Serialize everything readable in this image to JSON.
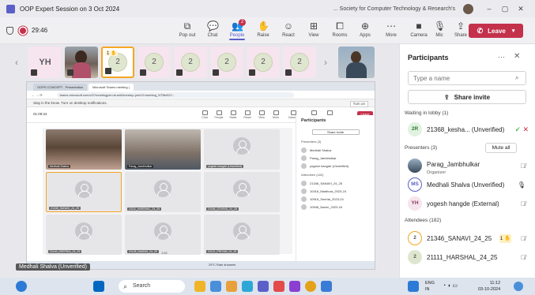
{
  "window": {
    "title": "OOP Expert Session on 3 Oct 2024",
    "org": "Society for Computer Technology & Research's",
    "more": "...",
    "min": "–",
    "max": "▢",
    "close": "✕"
  },
  "toolbar": {
    "timer": "29:46",
    "buttons": [
      {
        "label": "Pop out",
        "icon": "popout-icon",
        "glyph": "⧉"
      },
      {
        "label": "Chat",
        "icon": "chat-icon",
        "glyph": "💬"
      },
      {
        "label": "People",
        "icon": "people-icon",
        "glyph": "👥",
        "active": true,
        "badge": "2"
      },
      {
        "label": "Raise",
        "icon": "raise-hand-icon",
        "glyph": "✋"
      },
      {
        "label": "React",
        "icon": "react-icon",
        "glyph": "☺"
      },
      {
        "label": "View",
        "icon": "view-icon",
        "glyph": "⊞"
      },
      {
        "label": "Rooms",
        "icon": "rooms-icon",
        "glyph": "⧠"
      },
      {
        "label": "Apps",
        "icon": "apps-icon",
        "glyph": "⊕"
      },
      {
        "label": "More",
        "icon": "more-icon",
        "glyph": "⋯"
      },
      {
        "label": "Camera",
        "icon": "camera-icon",
        "glyph": "■"
      },
      {
        "label": "Mic",
        "icon": "mic-icon",
        "glyph": "🎙"
      },
      {
        "label": "Share",
        "icon": "share-icon",
        "glyph": "⇪"
      }
    ],
    "leave": "Leave"
  },
  "strip": {
    "tiles": [
      {
        "initials": "YH",
        "type": "initials"
      },
      {
        "type": "photo"
      },
      {
        "initials": "2",
        "type": "circle",
        "hand": "1 ✋",
        "highlight": true
      },
      {
        "initials": "2",
        "type": "circle"
      },
      {
        "initials": "2",
        "type": "circle"
      },
      {
        "initials": "2",
        "type": "circle"
      },
      {
        "initials": "2",
        "type": "circle"
      },
      {
        "initials": "2",
        "type": "circle"
      }
    ],
    "prev": "‹",
    "next": "›"
  },
  "shared": {
    "tabs": [
      "OOPS CONCEPT - Presentation",
      "Microsoft Teams meeting |"
    ],
    "url": "teams.microsoft.com/v2/?meetingjoin=true#/l/meetup-join/19:meeting_NTNkN2Y...",
    "notice": "Stay in the know. Turn on desktop notifications.",
    "turn_on": "Turn on",
    "time": "01:09:24",
    "tb_labels": [
      "Chat",
      "People",
      "Raise",
      "React",
      "View",
      "More",
      "Camera",
      "Mic",
      "Share"
    ],
    "leave": "Leave",
    "grid": [
      {
        "name": "Medhali Shalva",
        "photo": "ph1"
      },
      {
        "name": "Parag_Jambhulkar",
        "photo": "ph2"
      },
      {
        "name": "yogesh hangde (Unverified)"
      },
      {
        "name": "21346_SANAVI_24_25",
        "sel": true
      },
      {
        "name": "21111_HARSHAL_24_25"
      },
      {
        "name": "21166_GOVIND_24_25"
      },
      {
        "name": "21149_DEEPIKA_24_25"
      },
      {
        "name": "21128_NAMAN_24_25"
      },
      {
        "name": "21121_PRIYAM_24_25"
      }
    ],
    "page": "1/32",
    "panel_title": "Participants",
    "panel_share": "Share invite",
    "panel_sections": [
      "Presenters (3)",
      "Attendees (182)"
    ],
    "panel_rows": [
      "Medhali Shalva",
      "Parag_Jambhulkar",
      "yogesh hangde (Unverified)",
      "21346_SANAVI_24_25",
      "10416_Madhura_2023-24",
      "10916_Snehal_2023-24",
      "10946_Naren_2023-24"
    ],
    "task_weather": "29°C Rain showers"
  },
  "name_tag": "Medhali Shalva (Unverified)",
  "panel": {
    "title": "Participants",
    "search_placeholder": "Type a name",
    "share_invite": "Share invite",
    "lobby_header": "Waiting in lobby (1)",
    "presenters_header": "Presenters (3)",
    "mute_all": "Mute all",
    "attendees_header": "Attendees (182)",
    "lobby": [
      {
        "initials": "2R",
        "name": "21368_kesha... (Unverified)"
      }
    ],
    "presenters": [
      {
        "initials": "",
        "name": "Parag_Jambhulkar",
        "role": "Organizer",
        "photo": true
      },
      {
        "initials": "MS",
        "name": "Medhali Shalva (Unverified)"
      },
      {
        "initials": "YH",
        "name": "yogesh hangde (External)"
      }
    ],
    "attendees": [
      {
        "initials": "2",
        "name": "21346_SANAVI_24_25",
        "hand": "1 ✋"
      },
      {
        "initials": "2",
        "name": "21111_HARSHAL_24_25"
      }
    ]
  },
  "taskbar": {
    "search": "Search",
    "lang": "ENG",
    "region": "IN",
    "time": "11:12",
    "date": "03-10-2024"
  },
  "colors": {
    "brand": "#5b5fc7",
    "leave": "#c4314b",
    "highlight": "#f5a623"
  }
}
